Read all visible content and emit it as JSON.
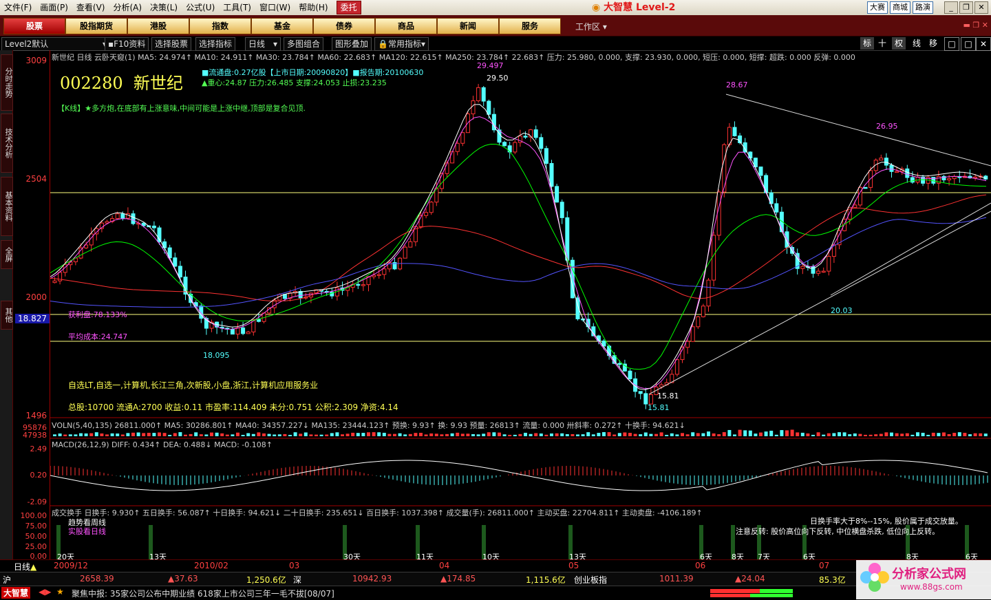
{
  "menu": {
    "items": [
      "文件(F)",
      "画面(P)",
      "查看(V)",
      "分析(A)",
      "决策(L)",
      "公式(U)",
      "工具(T)",
      "窗口(W)",
      "帮助(H)"
    ],
    "weituo": "委托"
  },
  "app": {
    "title": "大智慧 Level-2",
    "right_tabs": [
      "大赛",
      "商城",
      "路演"
    ]
  },
  "nav": {
    "buttons": [
      "股票",
      "股指期货",
      "港股",
      "指数",
      "基金",
      "债券",
      "商品",
      "新闻",
      "服务"
    ],
    "workzone": "工作区"
  },
  "toolbar": {
    "items": [
      "Level2默认",
      "F10资料",
      "选择股票",
      "选择指标",
      "日线",
      "多图组合",
      "图形叠加",
      "常用指标"
    ],
    "right": [
      "标",
      "十",
      "权",
      "线",
      "移"
    ]
  },
  "lefttabs": [
    "分时走势",
    "技术分析",
    "基本资料",
    "全屏",
    "其他"
  ],
  "yaxis": {
    "price": [
      "3009",
      "2504",
      "2000",
      "1496"
    ],
    "marker": "18.827",
    "vol": [
      "95876",
      "47938"
    ],
    "macd": [
      "2.49",
      "0.20",
      "-2.09"
    ],
    "hs": [
      "100.00",
      "75.00",
      "50.00",
      "25.00",
      "0.00"
    ]
  },
  "stock": {
    "code": "002280",
    "name": "新世纪",
    "float": "■流通盘:0.27亿股【上市日期:20090820】■报告期:20100630",
    "levels": "▲重心:24.87 压力:26.485 支撑:24.053 止损:23.235",
    "kline": "【K线】★多方炮,在底部有上涨意味,中间可能是上涨中继,顶部是复合见顶.",
    "profit": "获利盘:78.133%",
    "avgcost": "平均成本:24.747",
    "sectors": "自选LT,自选一,计算机,长江三角,次新股,小盘,浙江,计算机应用服务业",
    "fund": "总股:10700 流通A:2700 收益:0.11 市盈率:114.409 未分:0.751 公积:2.309 净资:4.14"
  },
  "mainstatus": "新世纪  日线 云卧天窥(1) MA5: 24.974↑ MA10: 24.911↑ MA30: 23.784↑ MA60: 22.683↑ MA120: 22.615↑ MA250: 23.784↑ 22.683↑ 压力: 25.980, 0.000, 支撑: 23.930, 0.000, 短压: 0.000, 短撑: 超跌: 0.000 反弹: 0.000",
  "annotations": {
    "high1": "29.497",
    "hi1b": "29.50",
    "high2": "28.67",
    "high3": "26.95",
    "low1": "18.095",
    "low2": "15.81",
    "low3": "20.03"
  },
  "volstatus": "VOLN(5,40,135) 26811.000↑ MA5: 30286.801↑ MA40: 34357.227↓ MA135: 23444.123↑ 预换: 9.93↑ 换: 9.93 预量: 26813↑ 流量: 0.000 卅斜率: 0.272↑ 十换手: 94.621↓",
  "macdstatus": "MACD(26,12,9) DIFF: 0.434↑ DEA: 0.488↓ MACD: -0.108↑",
  "hsstatus": "成交换手 日换手: 9.930↑ 五日换手: 56.087↑ 十日换手: 94.621↓ 二十日换手: 235.651↓ 百日换手: 1037.398↑ 成交量(手): 26811.000↑ 主动买盘: 22704.811↑ 主动卖盘: -4106.189↑",
  "hstext": {
    "t1": "趋势看周线",
    "t2": "实股看日线",
    "r1": "日换手率大于8%--15%, 股价属于成交放量。",
    "r2": "注意反转: 股价高位向下反转, 中位横盘杀跌, 低位向上反转。"
  },
  "hsdays": [
    "20天",
    "13天",
    "30天",
    "11天",
    "10天",
    "13天",
    "6天",
    "8天",
    "7天",
    "6天",
    "8天",
    "6天"
  ],
  "timeaxis": {
    "period": "日线",
    "ticks": [
      "2009/12",
      "2010/02",
      "03",
      "04",
      "05",
      "06",
      "07"
    ]
  },
  "market": {
    "sh": "沪",
    "sh_idx": "2658.39",
    "sh_chg": "▲37.63",
    "sh_amt": "1,250.6亿",
    "sz": "深",
    "sz_idx": "10942.93",
    "sz_chg": "▲174.85",
    "sz_amt": "1,115.6亿",
    "cyb": "创业板指",
    "cyb_idx": "1011.39",
    "cyb_chg": "▲24.04",
    "cyb_amt": "85.3亿"
  },
  "news": {
    "logo": "大智慧",
    "text": "聚焦中报: 35家公司公布中期业绩 618家上市公司三年一毛不拔[08/07]"
  },
  "watermark": {
    "cn": "分析家公式网",
    "url": "www.88gs.com"
  },
  "colors": {
    "up": "#ff3232",
    "down": "#54ffff",
    "ma5": "#ffffff",
    "ma10": "#ffff54",
    "ma30": "#ff54ff",
    "ma60": "#00ff00",
    "ma120": "#ff3232",
    "ma250": "#5454ff"
  }
}
